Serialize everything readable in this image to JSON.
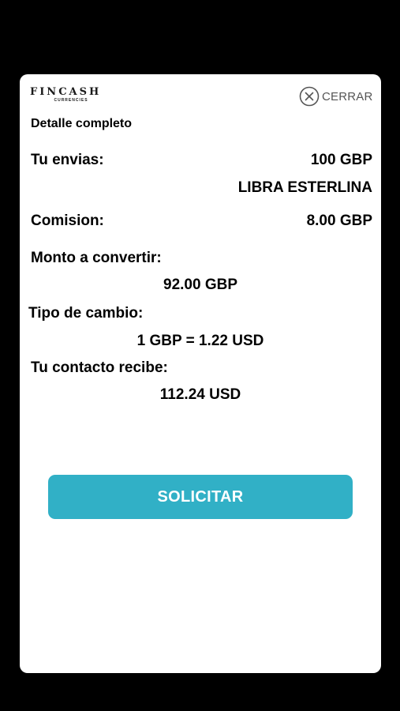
{
  "modal": {
    "logo": {
      "name": "FINCASH",
      "sub": "CURRENCIES"
    },
    "close_label": "CERRAR",
    "subtitle": "Detalle completo",
    "send": {
      "label": "Tu envias:",
      "amount": "100 GBP",
      "currency_name": "LIBRA ESTERLINA"
    },
    "commission": {
      "label": "Comision:",
      "amount": "8.00 GBP"
    },
    "convert": {
      "label": "Monto a convertir:",
      "amount": "92.00 GBP"
    },
    "rate": {
      "label": "Tipo de cambio:",
      "value": "1 GBP = 1.22 USD"
    },
    "receive": {
      "label": "Tu contacto recibe:",
      "amount": "112.24 USD"
    },
    "submit_label": "SOLICITAR"
  },
  "colors": {
    "background": "#000000",
    "card": "#ffffff",
    "accent": "#31b0c6",
    "text": "#000000",
    "close_gray": "#555555"
  }
}
